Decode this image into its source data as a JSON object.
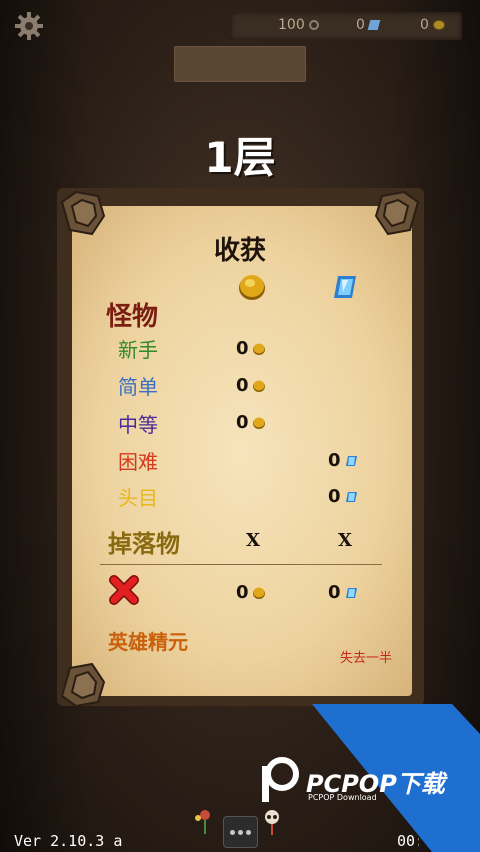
{
  "top_bar": {
    "time_value": "100",
    "gems_value": "0",
    "coins_value": "0"
  },
  "floor_title": "1层",
  "panel": {
    "title": "收获",
    "monsters_label": "怪物",
    "rows": [
      {
        "label": "新手",
        "coins": "0",
        "color": "#2f8a2a"
      },
      {
        "label": "简单",
        "coins": "0",
        "color": "#3a6fc4"
      },
      {
        "label": "中等",
        "coins": "0",
        "color": "#4a2a9a"
      },
      {
        "label": "困难",
        "gems": "0",
        "color": "#d43a1e"
      },
      {
        "label": "头目",
        "gems": "0",
        "color": "#e6b81a"
      }
    ],
    "drops_label": "掉落物",
    "drops_coins": "X",
    "drops_gems": "X",
    "death_coins": "0",
    "death_gems": "0",
    "hero_essence_label": "英雄精元",
    "lose_half_label": "失去一半"
  },
  "footer": {
    "version": "Ver 2.10.3 a",
    "timer": "00:0"
  },
  "watermark": {
    "brand": "PCPOP下载",
    "sub": "PCPOP Download"
  },
  "colors": {
    "coin": "#e0a818",
    "gem": "#5fb4f0",
    "watermark_blue": "#1f6fd1"
  }
}
